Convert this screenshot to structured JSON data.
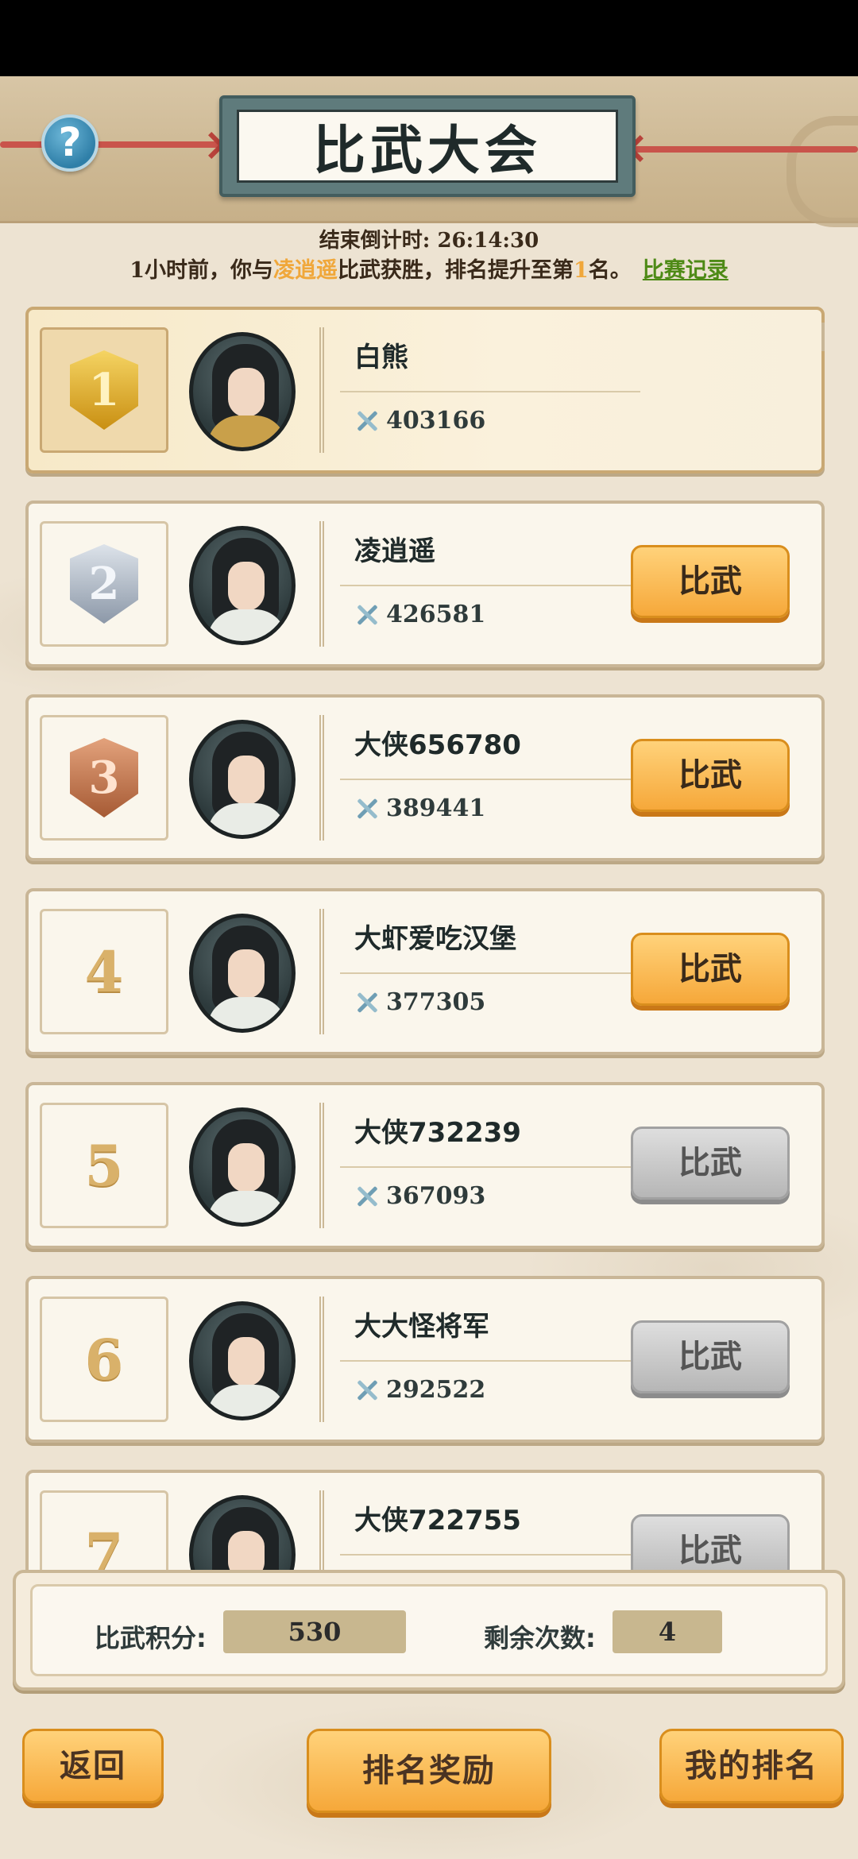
{
  "header": {
    "title": "比武大会",
    "help_icon": "question-icon",
    "help_glyph": "?"
  },
  "countdown": {
    "label": "结束倒计时:",
    "value": "26:14:30"
  },
  "notice": {
    "prefix": "1小时前，你与",
    "opponent": "凌逍遥",
    "middle": "比武获胜，排名提升至第",
    "rank": "1",
    "suffix": "名。",
    "record_link": "比赛记录"
  },
  "rankings": [
    {
      "rank": "1",
      "name": "白熊",
      "power": "403166",
      "badge": "gold"
    },
    {
      "rank": "2",
      "name": "凌逍遥",
      "power": "426581",
      "badge": "silver",
      "button": "比武",
      "button_enabled": true
    },
    {
      "rank": "3",
      "name": "大侠656780",
      "power": "389441",
      "badge": "bronze",
      "button": "比武",
      "button_enabled": true
    },
    {
      "rank": "4",
      "name": "大虾爱吃汉堡",
      "power": "377305",
      "button": "比武",
      "button_enabled": true
    },
    {
      "rank": "5",
      "name": "大侠732239",
      "power": "367093",
      "button": "比武",
      "button_enabled": false
    },
    {
      "rank": "6",
      "name": "大大怪将军",
      "power": "292522",
      "button": "比武",
      "button_enabled": false
    },
    {
      "rank": "7",
      "name": "大侠722755",
      "button": "比武",
      "button_enabled": false
    }
  ],
  "stats": {
    "score_label": "比武积分:",
    "score_value": "530",
    "remaining_label": "剩余次数:",
    "remaining_value": "4"
  },
  "footer": {
    "back": "返回",
    "rewards": "排名奖励",
    "my_rank": "我的排名"
  },
  "colors": {
    "background": "#ede3d2",
    "accent_orange": "#f6a83a",
    "highlight_name": "#f0a73a",
    "record_link": "#4e8a16",
    "disabled_button": "#b6b6b6"
  }
}
